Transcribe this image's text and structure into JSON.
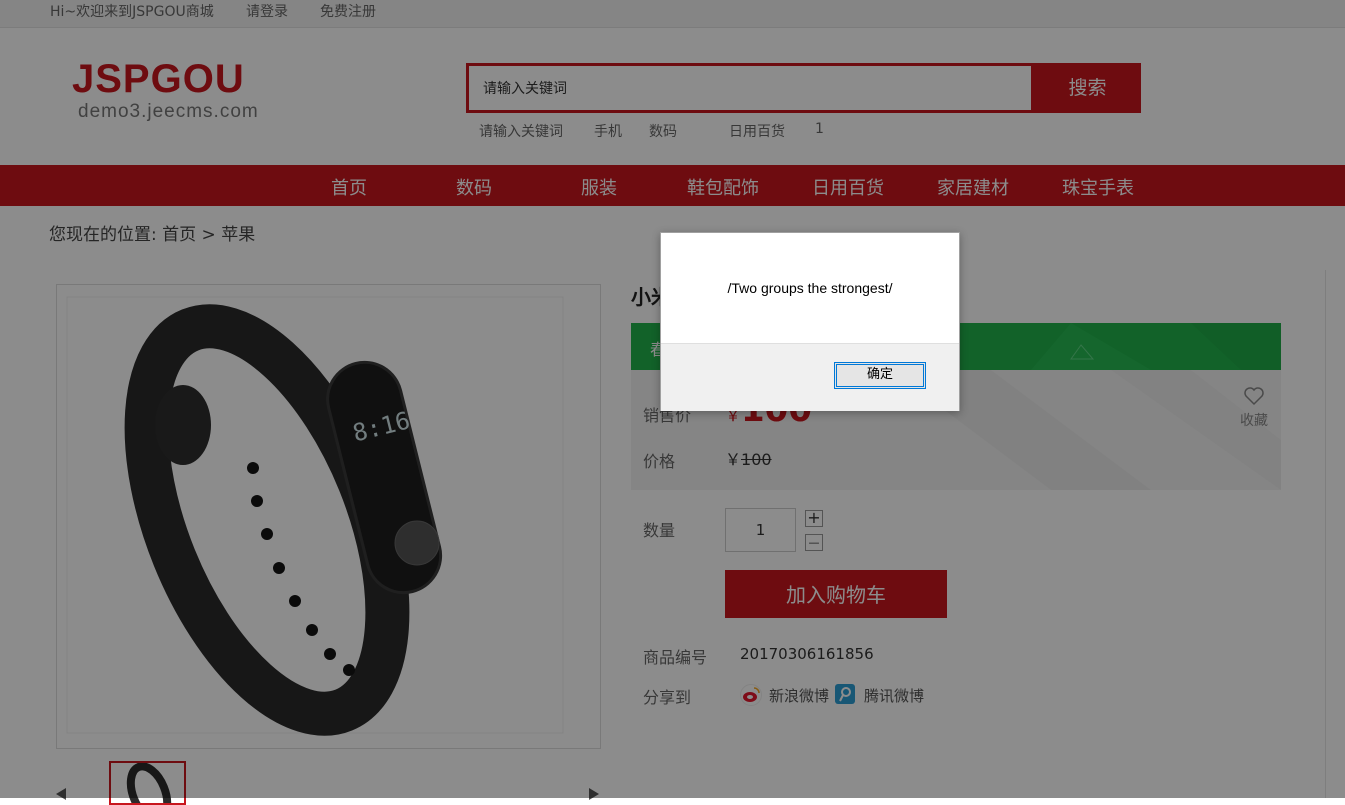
{
  "topbar": {
    "welcome": "Hi~欢迎来到JSPGOU商城",
    "login": "请登录",
    "register": "免费注册"
  },
  "logo": {
    "main": "JSPGOU",
    "sub": "demo3.jeecms.com"
  },
  "search": {
    "value": "请输入关键词",
    "button": "搜索",
    "hotwords": [
      "请输入关键词",
      "手机",
      "数码",
      "日用百货",
      "1"
    ]
  },
  "nav": [
    "首页",
    "数码",
    "服装",
    "鞋包配饰",
    "日用百货",
    "家居建材",
    "珠宝手表"
  ],
  "breadcrumb": {
    "prefix": "您现在的位置:",
    "home": "首页",
    "sep": ">",
    "current": "苹果"
  },
  "product": {
    "title": "小米",
    "promo_label": "春",
    "sale_label": "销售价",
    "currency": "￥",
    "sale_price": "100",
    "price_label": "价格",
    "orig_price": "100",
    "favorite": "收藏",
    "qty_label": "数量",
    "qty": "1",
    "plus": "+",
    "minus": "—",
    "add_to_cart": "加入购物车",
    "sku_label": "商品编号",
    "sku": "20170306161856",
    "share_label": "分享到",
    "share_weibo": "新浪微博",
    "share_tencent": "腾讯微博",
    "band_display": "8:16"
  },
  "dialog": {
    "message": "/Two groups the strongest/",
    "ok": "确定"
  },
  "colors": {
    "brand_red": "#c8161e",
    "promo_green": "#22b24c"
  },
  "icons": [
    "heart-icon",
    "weibo-icon",
    "tencent-weibo-icon",
    "arrow-left-icon",
    "arrow-right-icon"
  ]
}
